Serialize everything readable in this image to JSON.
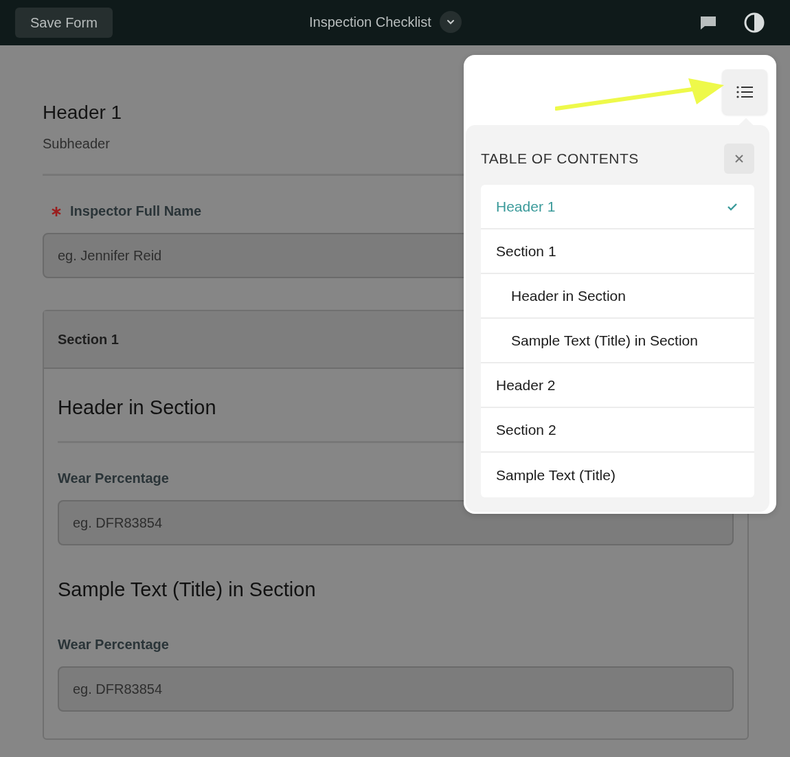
{
  "toolbar": {
    "save_button": "Save Form",
    "title": "Inspection Checklist"
  },
  "form": {
    "header": {
      "title": "Header 1",
      "subheader": "Subheader"
    },
    "fields": [
      {
        "label": "Inspector Full Name",
        "required": true,
        "placeholder": "eg. Jennifer Reid"
      }
    ],
    "section": {
      "title": "Section 1",
      "items": [
        {
          "kind": "heading",
          "text": "Header in Section"
        },
        {
          "kind": "field",
          "label": "Wear Percentage",
          "placeholder": "eg. DFR83854"
        },
        {
          "kind": "heading",
          "text": "Sample Text (Title) in Section"
        },
        {
          "kind": "field",
          "label": "Wear Percentage",
          "placeholder": "eg. DFR83854"
        }
      ]
    }
  },
  "toc": {
    "title": "TABLE OF CONTENTS",
    "items": [
      {
        "label": "Header 1",
        "selected": true
      },
      {
        "label": "Section 1",
        "selected": false,
        "children": [
          {
            "label": "Header in Section",
            "selected": false
          },
          {
            "label": "Sample Text (Title) in Section",
            "selected": false
          }
        ]
      },
      {
        "label": "Header 2",
        "selected": false
      },
      {
        "label": "Section 2",
        "selected": false
      },
      {
        "label": "Sample Text (Title)",
        "selected": false
      }
    ]
  }
}
